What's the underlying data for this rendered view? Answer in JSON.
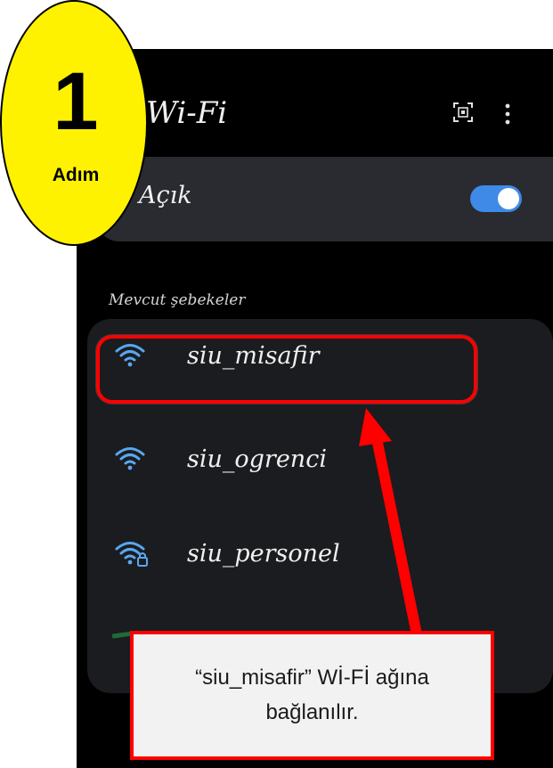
{
  "header": {
    "title": "Wi-Fi",
    "scan_icon": "qr-scan-icon",
    "menu_icon": "more-vert-icon"
  },
  "wifi_toggle": {
    "label": "Açık",
    "state": "on",
    "accent": "#3e8ae6"
  },
  "networks": {
    "section_label": "Mevcut şebekeler",
    "items": [
      {
        "name": "siu_misafir",
        "icon": "wifi-icon",
        "secured": false
      },
      {
        "name": "siu_ogrenci",
        "icon": "wifi-icon",
        "secured": false
      },
      {
        "name": "siu_personel",
        "icon": "wifi-lock-icon",
        "secured": true
      }
    ]
  },
  "step_badge": {
    "number": "1",
    "label": "Adım",
    "color": "#fff200"
  },
  "callout": {
    "text": "“siu_misafir” Wİ-Fİ ağına\nbağlanılır.",
    "border_color": "#ff0000"
  }
}
